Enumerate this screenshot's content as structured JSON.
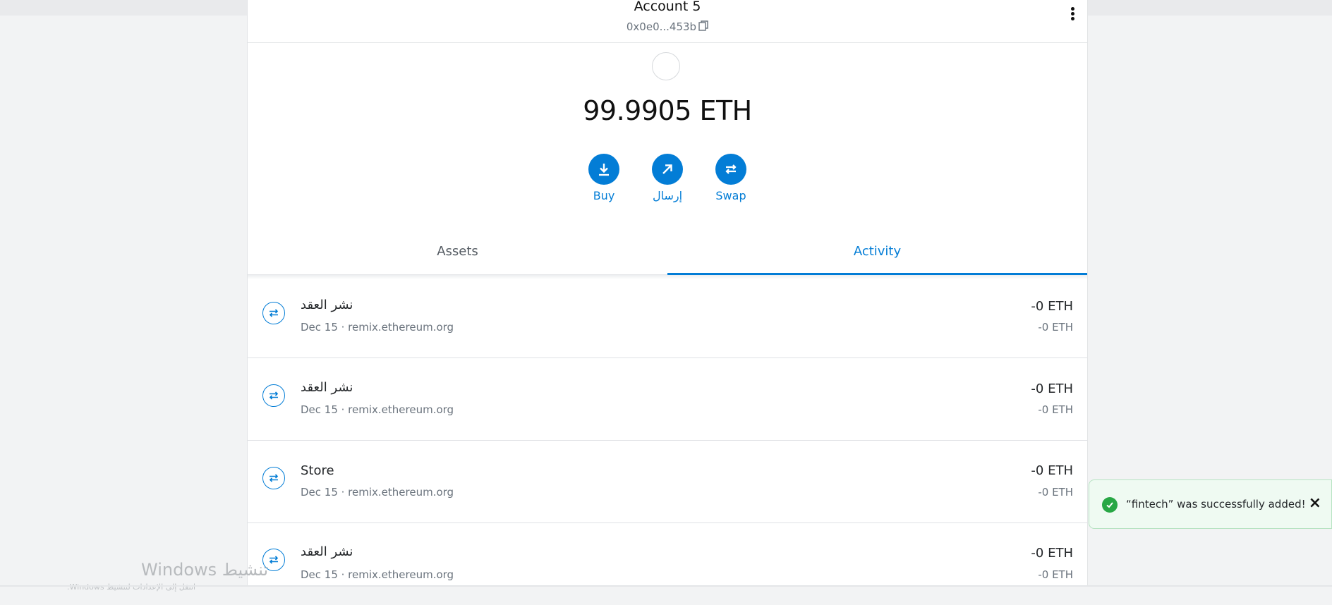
{
  "account": {
    "name": "Account 5",
    "address": "0x0e0...453b",
    "balance": "99.9905 ETH"
  },
  "actions": [
    {
      "label": "Buy",
      "icon": "download-icon"
    },
    {
      "label": "إرسال",
      "icon": "send-arrow-icon"
    },
    {
      "label": "Swap",
      "icon": "swap-icon"
    }
  ],
  "tabs": {
    "assets": "Assets",
    "activity": "Activity",
    "active": "activity"
  },
  "transactions": [
    {
      "title": "نشر العقد",
      "subtitle": "Dec 15 · remix.ethereum.org",
      "amount": "-0 ETH",
      "fiat": "-0 ETH"
    },
    {
      "title": "نشر العقد",
      "subtitle": "Dec 15 · remix.ethereum.org",
      "amount": "-0 ETH",
      "fiat": "-0 ETH"
    },
    {
      "title": "Store",
      "subtitle": "Dec 15 · remix.ethereum.org",
      "amount": "-0 ETH",
      "fiat": "-0 ETH"
    },
    {
      "title": "نشر العقد",
      "subtitle": "Dec 15 · remix.ethereum.org",
      "amount": "-0 ETH",
      "fiat": "-0 ETH"
    }
  ],
  "toast": {
    "message": "“fintech” was successfully added!",
    "close": "×"
  },
  "watermark": {
    "title": "تنشيط Windows",
    "subtitle": "انتقل إلى الإعدادات لتنشيط Windows."
  },
  "colors": {
    "accent": "#037dd6",
    "success": "#28a745",
    "toast_bg": "#effaf2"
  }
}
